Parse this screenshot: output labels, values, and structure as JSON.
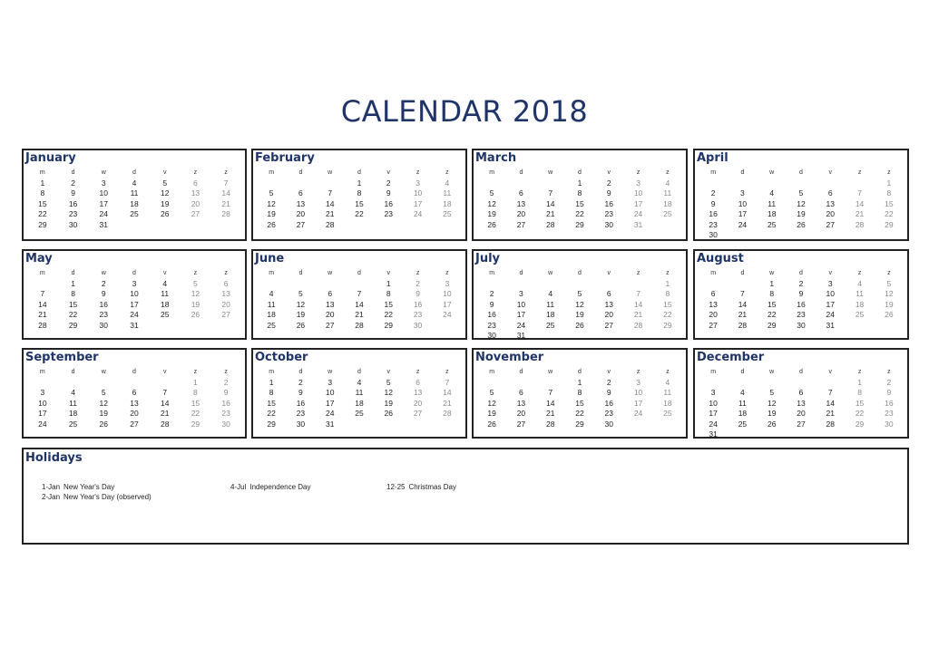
{
  "title": "CALENDAR 2018",
  "weekday_headers": [
    "m",
    "d",
    "w",
    "d",
    "v",
    "z",
    "z"
  ],
  "colors": {
    "accent": "#1f3468",
    "weekend": "#8a8a8a",
    "border": "#222222"
  },
  "months": [
    {
      "name": "January",
      "offset": 0,
      "days": 31
    },
    {
      "name": "February",
      "offset": 3,
      "days": 28
    },
    {
      "name": "March",
      "offset": 3,
      "days": 31
    },
    {
      "name": "April",
      "offset": 6,
      "days": 30
    },
    {
      "name": "May",
      "offset": 1,
      "days": 31
    },
    {
      "name": "June",
      "offset": 4,
      "days": 30
    },
    {
      "name": "July",
      "offset": 6,
      "days": 31
    },
    {
      "name": "August",
      "offset": 2,
      "days": 31
    },
    {
      "name": "September",
      "offset": 5,
      "days": 30
    },
    {
      "name": "October",
      "offset": 0,
      "days": 31
    },
    {
      "name": "November",
      "offset": 3,
      "days": 30
    },
    {
      "name": "December",
      "offset": 5,
      "days": 31
    }
  ],
  "holidays": {
    "title": "Holidays",
    "columns": [
      [
        {
          "date": "1-Jan",
          "name": "New Year's Day"
        },
        {
          "date": "2-Jan",
          "name": "New Year's Day (observed)"
        }
      ],
      [
        {
          "date": "4-Jul",
          "name": "Independence Day"
        }
      ],
      [
        {
          "date": "12-25",
          "name": "Christmas Day"
        }
      ]
    ]
  }
}
